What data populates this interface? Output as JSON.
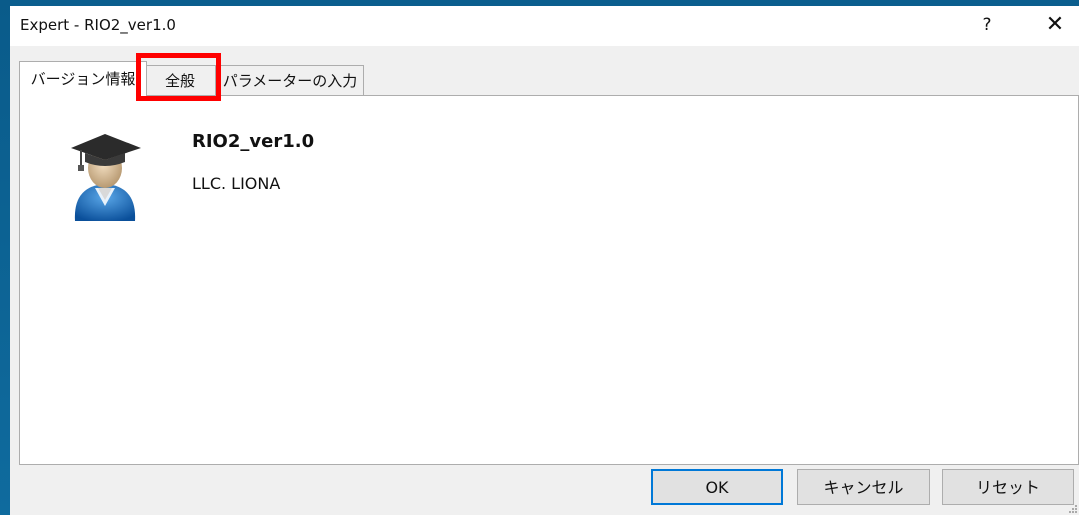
{
  "window": {
    "title": "Expert - RIO2_ver1.0",
    "help_label": "?",
    "close_label": "✕"
  },
  "tabs": [
    {
      "label": "バージョン情報",
      "selected": true
    },
    {
      "label": "全般",
      "selected": false,
      "highlighted": true
    },
    {
      "label": "パラメーターの入力",
      "selected": false
    }
  ],
  "about": {
    "name": "RIO2_ver1.0",
    "company": "LLC. LIONA",
    "icon": "graduate-avatar-icon"
  },
  "buttons": {
    "ok": "OK",
    "cancel": "キャンセル",
    "reset": "リセット"
  },
  "colors": {
    "highlight": "#ff0000",
    "default_button_border": "#0078d7",
    "desktop": "#0e5f8e"
  }
}
